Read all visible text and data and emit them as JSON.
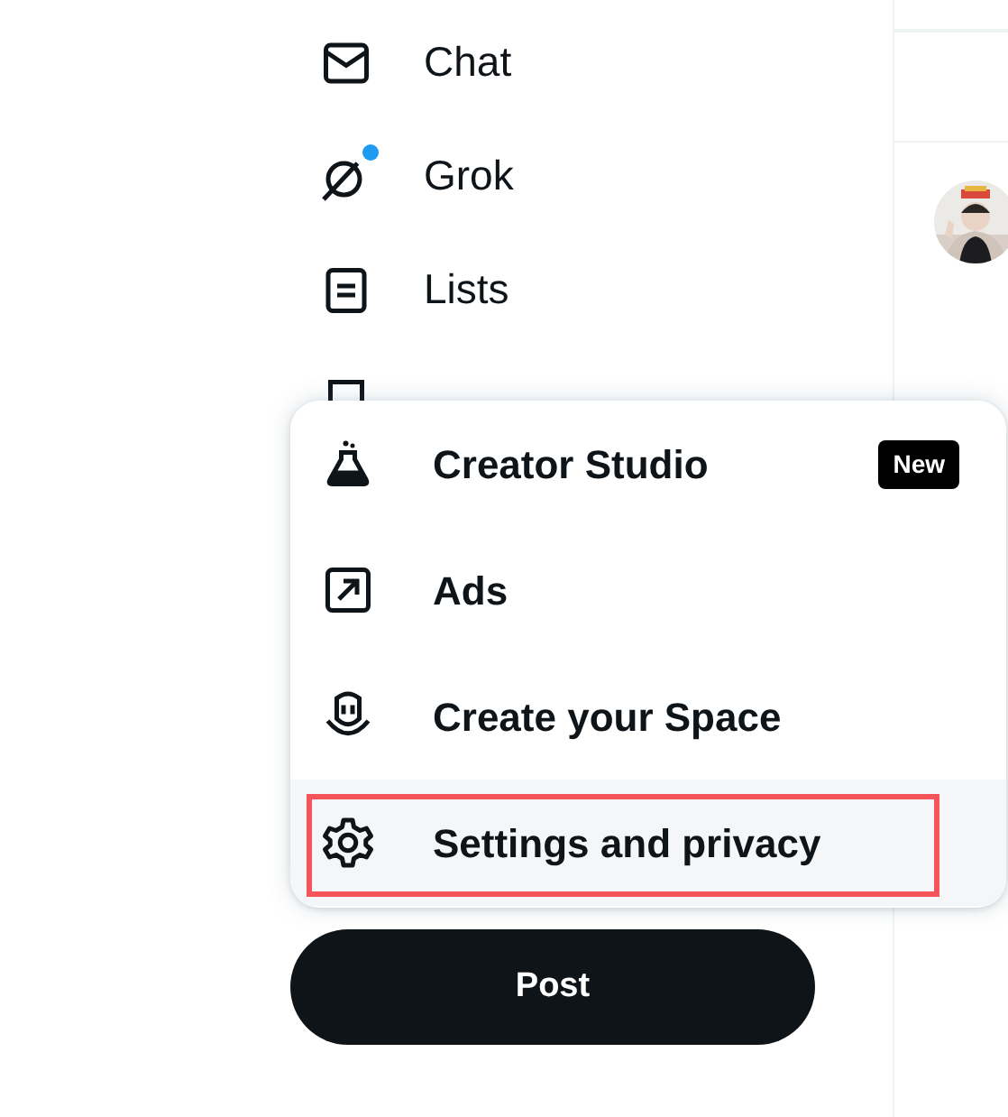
{
  "nav": [
    {
      "kind": "chat",
      "label": "Chat",
      "dot": false
    },
    {
      "kind": "grok",
      "label": "Grok",
      "dot": true
    },
    {
      "kind": "lists",
      "label": "Lists",
      "dot": false
    },
    {
      "kind": "bookmarks",
      "dot": false
    }
  ],
  "menu": [
    {
      "kind": "studio",
      "label": "Creator Studio",
      "badge": "New",
      "outlined": false
    },
    {
      "kind": "ads",
      "label": "Ads",
      "outlined": false
    },
    {
      "kind": "space",
      "label": "Create your Space",
      "outlined": false
    },
    {
      "kind": "settings",
      "label": "Settings and privacy",
      "outlined": true
    }
  ],
  "post_button": "Post"
}
